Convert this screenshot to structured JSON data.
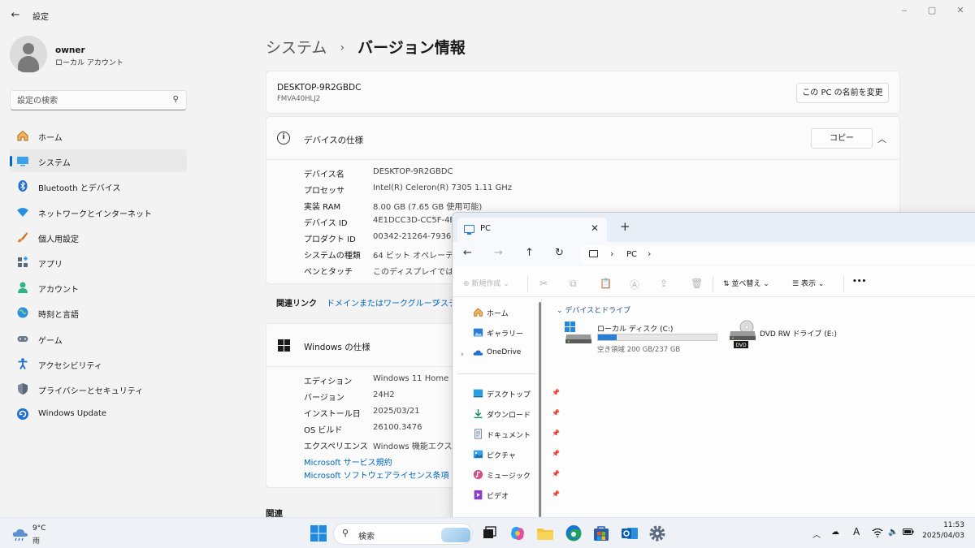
{
  "settings": {
    "app_title": "設定",
    "window_controls": {
      "minimize": "‒",
      "maximize": "▢",
      "close": "✕"
    },
    "user": {
      "name": "owner",
      "account_type": "ローカル アカウント"
    },
    "search": {
      "placeholder": "設定の検索"
    },
    "nav": [
      {
        "label": "ホーム",
        "icon": "home-icon"
      },
      {
        "label": "システム",
        "icon": "system-icon",
        "active": true
      },
      {
        "label": "Bluetooth とデバイス",
        "icon": "bluetooth-icon"
      },
      {
        "label": "ネットワークとインターネット",
        "icon": "wifi-icon"
      },
      {
        "label": "個人用設定",
        "icon": "brush-icon"
      },
      {
        "label": "アプリ",
        "icon": "apps-icon"
      },
      {
        "label": "アカウント",
        "icon": "account-icon"
      },
      {
        "label": "時刻と言語",
        "icon": "globe-icon"
      },
      {
        "label": "ゲーム",
        "icon": "gamepad-icon"
      },
      {
        "label": "アクセシビリティ",
        "icon": "accessibility-icon"
      },
      {
        "label": "プライバシーとセキュリティ",
        "icon": "shield-icon"
      },
      {
        "label": "Windows Update",
        "icon": "update-icon"
      }
    ],
    "breadcrumb": {
      "parent": "システム",
      "separator": "›",
      "current": "バージョン情報"
    },
    "device": {
      "name": "DESKTOP-9R2GBDC",
      "model": "FMVA40HLJ2",
      "rename_button": "この PC の名前を変更"
    },
    "device_specs": {
      "title": "デバイスの仕様",
      "copy_button": "コピー",
      "rows": [
        {
          "label": "デバイス名",
          "value": "DESKTOP-9R2GBDC"
        },
        {
          "label": "プロセッサ",
          "value": "Intel(R) Celeron(R) 7305   1.11 GHz"
        },
        {
          "label": "実装 RAM",
          "value": "8.00 GB (7.65 GB 使用可能)"
        },
        {
          "label": "デバイス ID",
          "value": "4E1DCC3D-CC5F-4E"
        },
        {
          "label": "プロダクト ID",
          "value": "00342-21264-79363"
        },
        {
          "label": "システムの種類",
          "value": "64 ビット オペレーティン"
        },
        {
          "label": "ペンとタッチ",
          "value": "このディスプレイでは、ペ"
        }
      ]
    },
    "related_links": {
      "label": "関連リンク",
      "link1": "ドメインまたはワークグループ",
      "link2": "システ"
    },
    "windows_specs": {
      "title": "Windows の仕様",
      "rows": [
        {
          "label": "エディション",
          "value": "Windows 11 Home"
        },
        {
          "label": "バージョン",
          "value": "24H2"
        },
        {
          "label": "インストール日",
          "value": "2025/03/21"
        },
        {
          "label": "OS ビルド",
          "value": "26100.3476"
        },
        {
          "label": "エクスペリエンス",
          "value": "Windows 機能エクスペ"
        }
      ],
      "links": [
        "Microsoft サービス規約",
        "Microsoft ソフトウェアライセンス条項"
      ]
    },
    "related_title": "関連"
  },
  "explorer": {
    "tab_label": "PC",
    "new_tab": "+",
    "address": {
      "location": "PC"
    },
    "toolbar": {
      "new": "新規作成",
      "sort": "並べ替え",
      "view": "表示",
      "more": "•••"
    },
    "sidebar": [
      {
        "label": "ホーム",
        "icon": "home-icon"
      },
      {
        "label": "ギャラリー",
        "icon": "gallery-icon"
      },
      {
        "label": "OneDrive",
        "icon": "cloud-icon",
        "expandable": true
      },
      {
        "label": "デスクトップ",
        "icon": "desktop-icon",
        "pinned": true
      },
      {
        "label": "ダウンロード",
        "icon": "download-icon",
        "pinned": true
      },
      {
        "label": "ドキュメント",
        "icon": "document-icon",
        "pinned": true
      },
      {
        "label": "ピクチャ",
        "icon": "picture-icon",
        "pinned": true
      },
      {
        "label": "ミュージック",
        "icon": "music-icon",
        "pinned": true
      },
      {
        "label": "ビデオ",
        "icon": "video-icon",
        "pinned": true
      }
    ],
    "group_title": "デバイスとドライブ",
    "drives": {
      "c": {
        "name": "ローカル ディスク (C:)",
        "free": "空き領域 200 GB/237 GB",
        "used_fraction": 0.16
      },
      "e": {
        "name": "DVD RW ドライブ (E:)",
        "badge": "DVD"
      }
    }
  },
  "taskbar": {
    "weather": {
      "temp": "9°C",
      "condition": "雨"
    },
    "search_label": "検索",
    "clock": {
      "time": "11:53",
      "date": "2025/04/03"
    },
    "ime": "A"
  },
  "colors": {
    "accent": "#0067c0",
    "link": "#0067c0",
    "drive_fill": "#2a7fd4"
  }
}
